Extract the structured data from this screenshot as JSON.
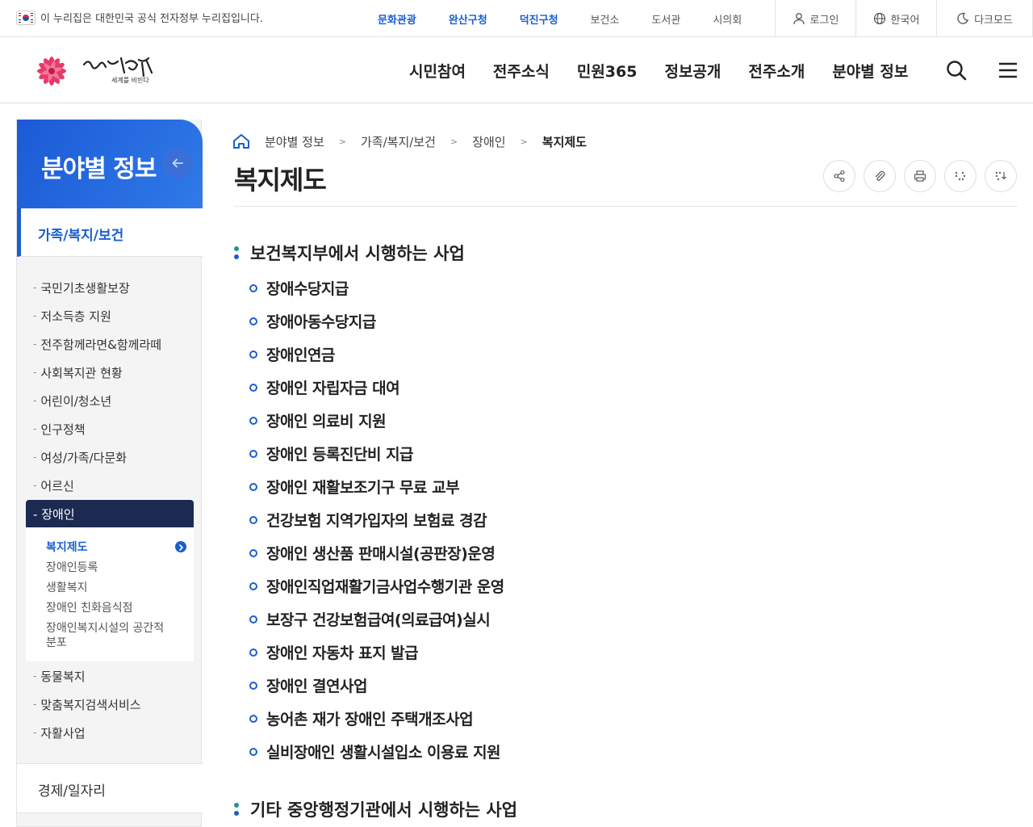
{
  "gov_notice": "이 누리집은 대한민국 공식 전자정부 누리집입니다.",
  "sites": [
    {
      "label": "문화관광",
      "highlight": true
    },
    {
      "label": "완산구청",
      "highlight": true
    },
    {
      "label": "덕진구청",
      "highlight": true
    },
    {
      "label": "보건소",
      "highlight": false
    },
    {
      "label": "도서관",
      "highlight": false
    },
    {
      "label": "시의회",
      "highlight": false
    }
  ],
  "util": {
    "login": "로그인",
    "language": "한국어",
    "darkmode": "다크모드"
  },
  "logo": {
    "script": "한바탕전주",
    "tagline": "세계를 비빈다"
  },
  "gnb": [
    "시민참여",
    "전주소식",
    "민원365",
    "정보공개",
    "전주소개",
    "분야별 정보"
  ],
  "sidebar": {
    "title": "분야별 정보",
    "category": "가족/복지/보건",
    "menu": [
      "국민기초생활보장",
      "저소득층 지원",
      "전주함께라면&함께라떼",
      "사회복지관 현황",
      "어린이/청소년",
      "인구정책",
      "여성/가족/다문화",
      "어르신"
    ],
    "active": "장애인",
    "submenu": [
      "복지제도",
      "장애인등록",
      "생활복지",
      "장애인 친화음식점",
      "장애인복지시설의 공간적 분포"
    ],
    "menu_after": [
      "동물복지",
      "맞춤복지검색서비스",
      "자활사업"
    ],
    "next_category": "경제/일자리"
  },
  "breadcrumb": [
    "분야별 정보",
    "가족/복지/보건",
    "장애인",
    "복지제도"
  ],
  "page_title": "복지제도",
  "section1_title": "보건복지부에서 시행하는 사업",
  "section1_items": [
    "장애수당지급",
    "장애아동수당지급",
    "장애인연금",
    "장애인 자립자금 대여",
    "장애인 의료비 지원",
    "장애인 등록진단비 지급",
    "장애인 재활보조기구 무료 교부",
    "건강보험 지역가입자의 보험료 경감",
    "장애인 생산품 판매시설(공판장)운영",
    "장애인직업재활기금사업수행기관 운영",
    "보장구 건강보험급여(의료급여)실시",
    "장애인 자동차 표지 발급",
    "장애인 결연사업",
    "농어촌 재가 장애인 주택개조사업",
    "실비장애인 생활시설입소 이용료 지원"
  ],
  "section2_title": "기타 중앙행정기관에서 시행하는 사업"
}
